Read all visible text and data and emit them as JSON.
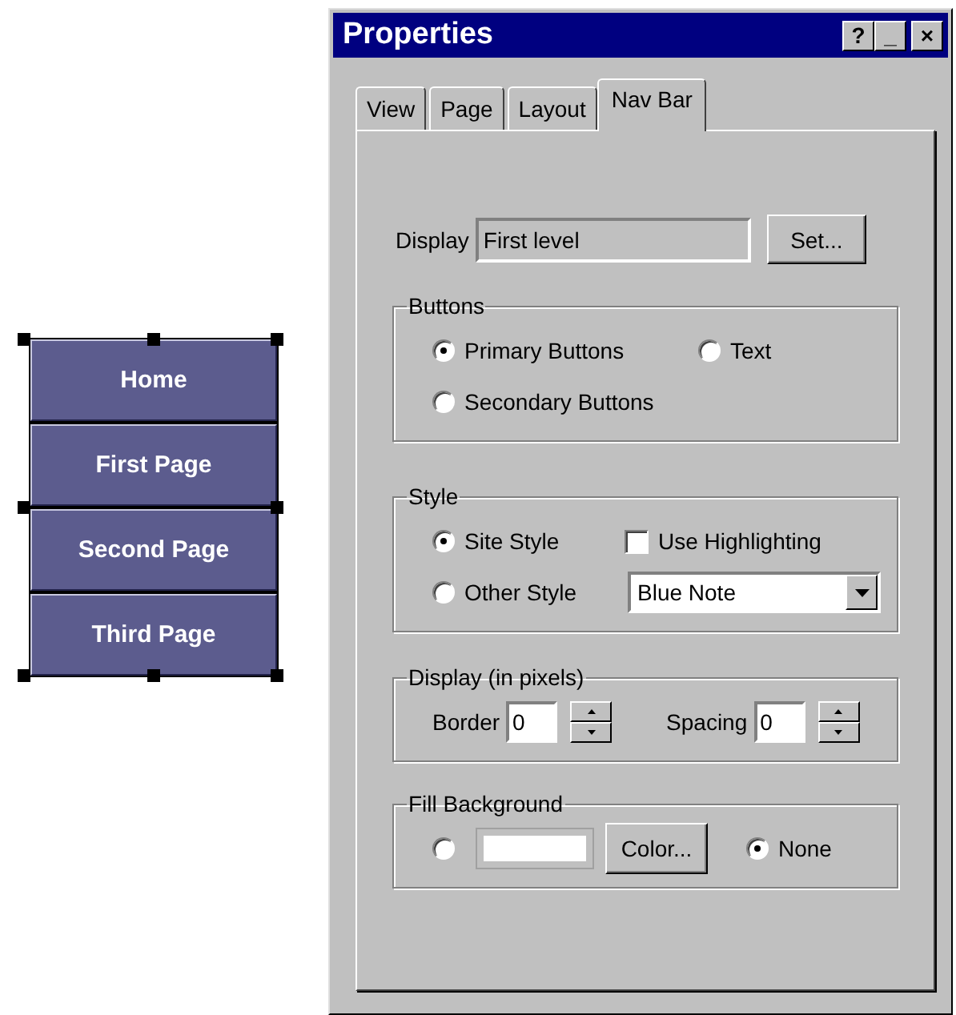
{
  "nav_preview": {
    "buttons": [
      "Home",
      "First Page",
      "Second Page",
      "Third Page"
    ]
  },
  "window": {
    "title": "Properties",
    "title_buttons": [
      "?",
      "_",
      "×"
    ]
  },
  "tabs": [
    {
      "label": "View",
      "selected": false
    },
    {
      "label": "Page",
      "selected": false
    },
    {
      "label": "Layout",
      "selected": false
    },
    {
      "label": "Nav Bar",
      "selected": true
    }
  ],
  "display": {
    "label": "Display",
    "value": "First level",
    "button": "Set..."
  },
  "buttons_group": {
    "title": "Buttons",
    "options": [
      {
        "label": "Primary Buttons",
        "selected": true
      },
      {
        "label": "Text",
        "selected": false
      },
      {
        "label": "Secondary Buttons",
        "selected": false
      }
    ]
  },
  "style_group": {
    "title": "Style",
    "options": [
      {
        "label": "Site Style",
        "selected": true
      },
      {
        "label": "Other Style",
        "selected": false
      }
    ],
    "highlight": {
      "label": "Use Highlighting",
      "checked": false
    },
    "dropdown": {
      "value": "Blue Note"
    }
  },
  "pixels_group": {
    "title": "Display (in pixels)",
    "fields": [
      {
        "label": "Border",
        "value": "0"
      },
      {
        "label": "Spacing",
        "value": "0"
      }
    ]
  },
  "fill_group": {
    "title": "Fill Background",
    "options": [
      {
        "selected": false
      },
      {
        "label": "None",
        "selected": true
      }
    ],
    "button": "Color..."
  }
}
